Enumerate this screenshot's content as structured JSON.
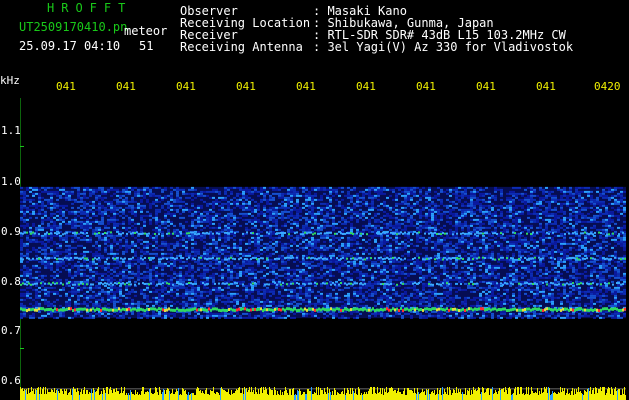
{
  "header": {
    "station_code": "HROFFT",
    "file_name": "UT2509170410.pn",
    "file_suffix": "meteor",
    "date_time": "25.09.17 04:10",
    "count": "51",
    "fields": [
      {
        "label": "Observer",
        "value": ": Masaki Kano"
      },
      {
        "label": "Receiving Location",
        "value": ": Shibukawa, Gunma, Japan"
      },
      {
        "label": "Receiver",
        "value": ": RTL-SDR SDR# 43dB L15 103.2MHz CW"
      },
      {
        "label": "Receiving Antenna",
        "value": ": 3el Yagi(V) Az 330 for Vladivostok"
      }
    ]
  },
  "chart_data": {
    "type": "heatmap",
    "ylabel": "kHz",
    "y_ticks": [
      "1.1",
      "1.0",
      "0.9",
      "0.8",
      "0.7",
      "0.6"
    ],
    "x_ticks": [
      "041",
      "041",
      "041",
      "041",
      "041",
      "041",
      "041",
      "041",
      "041",
      "0420"
    ],
    "ylim": [
      0.6,
      1.15
    ],
    "signal_band_khz": [
      0.76,
      1.02
    ],
    "strong_lines_khz": [
      0.78,
      0.83,
      0.88,
      0.93
    ],
    "colors": {
      "background": "#000000",
      "low": "#0a1aa0",
      "mid": "#2aa0ff",
      "high": "#30d860",
      "peak": "#ff3030",
      "axis": "#19c819",
      "level_bar": "#f0f000"
    }
  }
}
